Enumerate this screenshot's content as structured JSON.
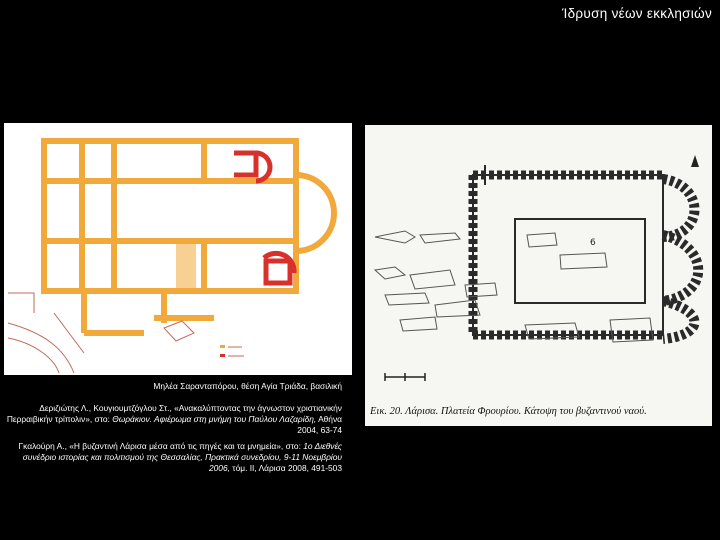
{
  "slide": {
    "title": "Ίδρυση νέων εκκλησιών"
  },
  "left_figure": {
    "site_caption": "Μηλέα Σαρανταπόρου, θέση Αγία Τριάδα, βασιλική",
    "ref1_plain": "Δεριζιώτης Λ., Κουγιουμτζόγλου Στ., «Ανακαλύπτοντας την άγνωστον χριστιανικήν Περραιβικήν τρίπολιν», στο:",
    "ref1_italic": "Θωράκιον. Αφιέρωμα στη μνήμη του Παύλου Λαζαρίδη,",
    "ref1_end": "Αθήνα 2004, 63-74",
    "ref2_plain": "Γκαλούρη Α., «Η βυζαντινή Λάρισα μέσα από τις πηγές και τα μνημεία»,",
    "ref2_pre": "στο:",
    "ref2_italic": "1ο Διεθνές συνέδριο ιστορίας και πολιτισμού της Θεσσαλίας, Πρακτικά συνεδρίου, 9-11 Νοεμβρίου 2006,",
    "ref2_end": "τόμ. ΙΙ, Λάρισα 2008, 491-503",
    "colors": {
      "older_phase": "#f2a93b",
      "later_phase": "#d8302a"
    }
  },
  "right_figure": {
    "caption": "Εικ. 20. Λάρισα. Πλατεία Φρουρίου. Κάτοψη του βυζαντινού ναού."
  }
}
